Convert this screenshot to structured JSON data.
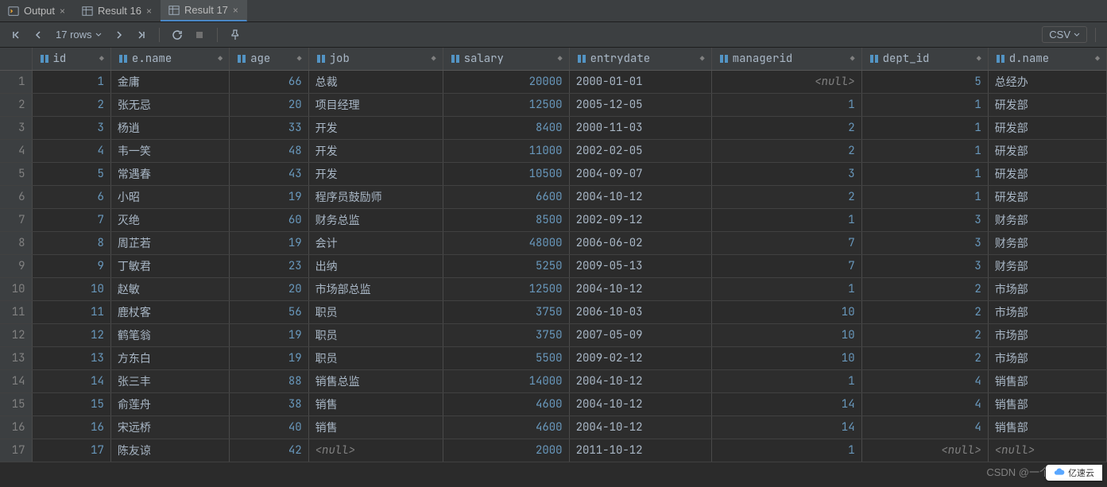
{
  "tabs": {
    "output": "Output",
    "result16": "Result 16",
    "result17": "Result 17"
  },
  "toolbar": {
    "row_count": "17 rows",
    "csv": "CSV"
  },
  "columns": [
    "id",
    "e.name",
    "age",
    "job",
    "salary",
    "entrydate",
    "managerid",
    "dept_id",
    "d.name"
  ],
  "col_align": [
    "num",
    "txt",
    "num",
    "txt",
    "num",
    "txt",
    "num",
    "num",
    "txt"
  ],
  "rows": [
    {
      "n": 1,
      "id": 1,
      "ename": "金庸",
      "age": 66,
      "job": "总裁",
      "salary": 20000,
      "entry": "2000-01-01",
      "mgr": null,
      "dept": 5,
      "dname": "总经办"
    },
    {
      "n": 2,
      "id": 2,
      "ename": "张无忌",
      "age": 20,
      "job": "项目经理",
      "salary": 12500,
      "entry": "2005-12-05",
      "mgr": 1,
      "dept": 1,
      "dname": "研发部"
    },
    {
      "n": 3,
      "id": 3,
      "ename": "杨逍",
      "age": 33,
      "job": "开发",
      "salary": 8400,
      "entry": "2000-11-03",
      "mgr": 2,
      "dept": 1,
      "dname": "研发部"
    },
    {
      "n": 4,
      "id": 4,
      "ename": "韦一笑",
      "age": 48,
      "job": "开发",
      "salary": 11000,
      "entry": "2002-02-05",
      "mgr": 2,
      "dept": 1,
      "dname": "研发部"
    },
    {
      "n": 5,
      "id": 5,
      "ename": "常遇春",
      "age": 43,
      "job": "开发",
      "salary": 10500,
      "entry": "2004-09-07",
      "mgr": 3,
      "dept": 1,
      "dname": "研发部"
    },
    {
      "n": 6,
      "id": 6,
      "ename": "小昭",
      "age": 19,
      "job": "程序员鼓励师",
      "salary": 6600,
      "entry": "2004-10-12",
      "mgr": 2,
      "dept": 1,
      "dname": "研发部"
    },
    {
      "n": 7,
      "id": 7,
      "ename": "灭绝",
      "age": 60,
      "job": "财务总监",
      "salary": 8500,
      "entry": "2002-09-12",
      "mgr": 1,
      "dept": 3,
      "dname": "财务部"
    },
    {
      "n": 8,
      "id": 8,
      "ename": "周芷若",
      "age": 19,
      "job": "会计",
      "salary": 48000,
      "entry": "2006-06-02",
      "mgr": 7,
      "dept": 3,
      "dname": "财务部"
    },
    {
      "n": 9,
      "id": 9,
      "ename": "丁敏君",
      "age": 23,
      "job": "出纳",
      "salary": 5250,
      "entry": "2009-05-13",
      "mgr": 7,
      "dept": 3,
      "dname": "财务部"
    },
    {
      "n": 10,
      "id": 10,
      "ename": "赵敏",
      "age": 20,
      "job": "市场部总监",
      "salary": 12500,
      "entry": "2004-10-12",
      "mgr": 1,
      "dept": 2,
      "dname": "市场部"
    },
    {
      "n": 11,
      "id": 11,
      "ename": "鹿杖客",
      "age": 56,
      "job": "职员",
      "salary": 3750,
      "entry": "2006-10-03",
      "mgr": 10,
      "dept": 2,
      "dname": "市场部"
    },
    {
      "n": 12,
      "id": 12,
      "ename": "鹤笔翁",
      "age": 19,
      "job": "职员",
      "salary": 3750,
      "entry": "2007-05-09",
      "mgr": 10,
      "dept": 2,
      "dname": "市场部"
    },
    {
      "n": 13,
      "id": 13,
      "ename": "方东白",
      "age": 19,
      "job": "职员",
      "salary": 5500,
      "entry": "2009-02-12",
      "mgr": 10,
      "dept": 2,
      "dname": "市场部"
    },
    {
      "n": 14,
      "id": 14,
      "ename": "张三丰",
      "age": 88,
      "job": "销售总监",
      "salary": 14000,
      "entry": "2004-10-12",
      "mgr": 1,
      "dept": 4,
      "dname": "销售部"
    },
    {
      "n": 15,
      "id": 15,
      "ename": "俞莲舟",
      "age": 38,
      "job": "销售",
      "salary": 4600,
      "entry": "2004-10-12",
      "mgr": 14,
      "dept": 4,
      "dname": "销售部"
    },
    {
      "n": 16,
      "id": 16,
      "ename": "宋远桥",
      "age": 40,
      "job": "销售",
      "salary": 4600,
      "entry": "2004-10-12",
      "mgr": 14,
      "dept": 4,
      "dname": "销售部"
    },
    {
      "n": 17,
      "id": 17,
      "ename": "陈友谅",
      "age": 42,
      "job": null,
      "salary": 2000,
      "entry": "2011-10-12",
      "mgr": 1,
      "dept": null,
      "dname": null
    }
  ],
  "null_text": "<null>",
  "watermark": "CSDN @一个热爱编程",
  "brand": "亿速云"
}
